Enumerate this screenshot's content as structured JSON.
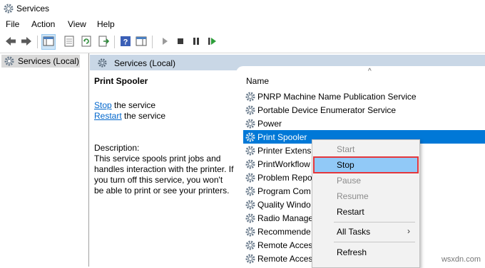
{
  "window": {
    "title": "Services"
  },
  "menu": [
    "File",
    "Action",
    "View",
    "Help"
  ],
  "tree": {
    "root": "Services (Local)"
  },
  "pane": {
    "header": "Services (Local)"
  },
  "description": {
    "service_name": "Print Spooler",
    "stop_link": "Stop",
    "stop_suffix": " the service",
    "restart_link": "Restart",
    "restart_suffix": " the service",
    "desc_label": "Description:",
    "desc_text": "This service spools print jobs and handles interaction with the printer. If you turn off this service, you won't be able to print or see your printers."
  },
  "list": {
    "column": "Name",
    "rows": [
      "PNRP Machine Name Publication Service",
      "Portable Device Enumerator Service",
      "Power",
      "Print Spooler",
      "Printer Extensi",
      "PrintWorkflow",
      "Problem Repo",
      "Program Com",
      "Quality Windo",
      "Radio Manage",
      "Recommende",
      "Remote Acces",
      "Remote Acces"
    ],
    "selected_index": 3
  },
  "context_menu": {
    "items": [
      "Start",
      "Stop",
      "Pause",
      "Resume",
      "Restart",
      "All Tasks",
      "Refresh"
    ]
  },
  "watermark": "wsxdn.com",
  "colors": {
    "selection": "#0078d7",
    "highlight": "#91c9f7",
    "highlight_border": "#e5363b",
    "header": "#c9d7e6"
  }
}
